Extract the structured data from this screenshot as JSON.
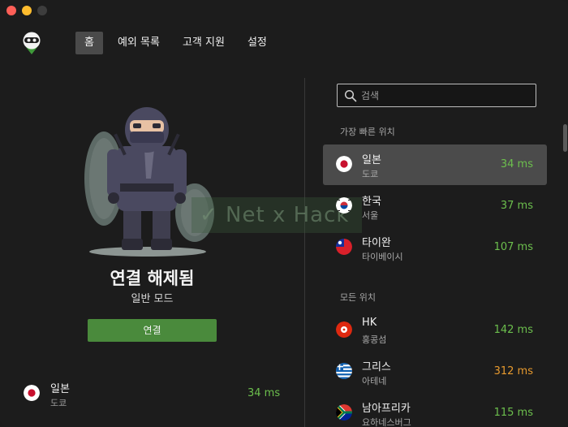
{
  "nav": {
    "items": [
      {
        "label": "홈",
        "active": true
      },
      {
        "label": "예외 목록",
        "active": false
      },
      {
        "label": "고객 지원",
        "active": false
      },
      {
        "label": "설정",
        "active": false
      }
    ]
  },
  "hero": {
    "watermark": "✓ Net x Hack"
  },
  "status": {
    "title": "연결 해제됨",
    "mode": "일반 모드",
    "connect_label": "연결"
  },
  "current": {
    "country": "일본",
    "city": "도쿄",
    "ping": "34 ms",
    "flag": "jp-flag-icon"
  },
  "search": {
    "placeholder": "검색"
  },
  "sections": {
    "fastest": "가장 빠른 위치",
    "all": "모든 위치"
  },
  "fastest": [
    {
      "country": "일본",
      "city": "도쿄",
      "ping": "34 ms",
      "flag": "jp-flag-icon",
      "selected": true
    },
    {
      "country": "한국",
      "city": "서울",
      "ping": "37 ms",
      "flag": "kr-flag-icon",
      "selected": false
    },
    {
      "country": "타이완",
      "city": "타이베이시",
      "ping": "107 ms",
      "flag": "tw-flag-icon",
      "selected": false
    }
  ],
  "all": [
    {
      "country": "HK",
      "city": "홍콩섬",
      "ping": "142 ms",
      "flag": "hk-flag-icon"
    },
    {
      "country": "그리스",
      "city": "아테네",
      "ping": "312 ms",
      "flag": "gr-flag-icon"
    },
    {
      "country": "남아프리카",
      "city": "요하네스버그",
      "ping": "115 ms",
      "flag": "za-flag-icon"
    }
  ],
  "colors": {
    "ping_good": "#6cbf4d",
    "ping_warn": "#e79a2e",
    "connect_button": "#4a8a3c",
    "selected_row": "#4b4b4b"
  }
}
